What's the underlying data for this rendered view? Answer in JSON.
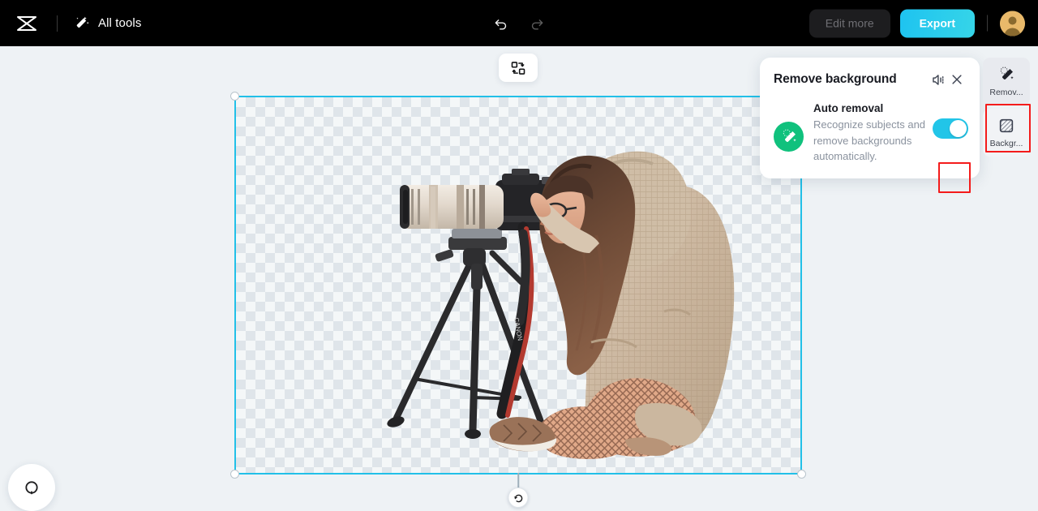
{
  "app": {
    "name": "CapCut",
    "logo_icon": "capcut-logo-icon"
  },
  "topbar": {
    "all_tools_label": "All tools",
    "all_tools_icon": "magic-wand-icon",
    "undo_icon": "undo-arrow-icon",
    "redo_icon": "redo-arrow-icon",
    "edit_more_label": "Edit more",
    "export_label": "Export",
    "avatar_icon": "user-avatar-icon",
    "export_color": "#22c3ec",
    "bar_color": "#000000"
  },
  "workspace": {
    "background_color": "#eef2f5",
    "replace_tool_icon": "swap-replace-icon",
    "help_icon": "help-circle-icon"
  },
  "canvas": {
    "selection_border_color": "#22c0e8",
    "checker_light": "#f4f7f8",
    "checker_dark": "#dfe5ea",
    "rotate_handle_icon": "rotate-handle-icon",
    "subject_description": "Woman in hooded sweater sitting cross-legged photographing with a DSLR camera on a tripod"
  },
  "remove_background_panel": {
    "title": "Remove background",
    "speaker_icon": "speaker-icon",
    "close_icon": "close-icon",
    "feature_icon": "magic-eraser-icon",
    "feature_icon_color": "#10c17d",
    "auto_removal_title": "Auto removal",
    "auto_removal_description": "Recognize subjects and remove backgrounds automatically.",
    "toggle_state": "on",
    "toggle_color": "#22c5e8",
    "annotation_color": "#f41b1b"
  },
  "right_rail": {
    "items": [
      {
        "label": "Remov...",
        "icon": "magic-eraser-icon",
        "active": true
      },
      {
        "label": "Backgr...",
        "icon": "hatched-square-icon",
        "active": false
      }
    ]
  }
}
